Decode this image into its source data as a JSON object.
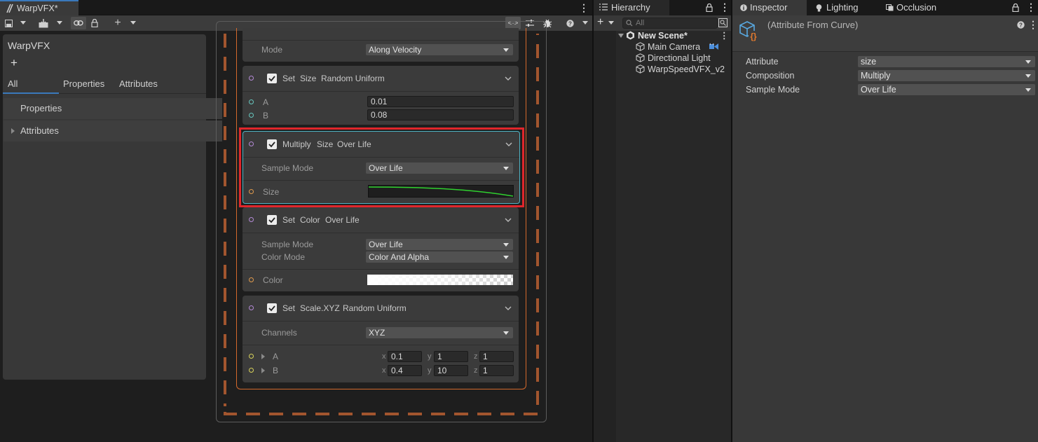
{
  "vfx": {
    "tab_title": "WarpVFX*",
    "blackboard": {
      "title": "WarpVFX",
      "add": "+",
      "tabs": [
        "All",
        "Properties",
        "Attributes"
      ],
      "rows": [
        "Properties",
        "Attributes"
      ]
    },
    "blocks": {
      "top": {
        "mode_label": "Mode",
        "mode_value": "Along Velocity"
      },
      "set_size": {
        "words": [
          "Set",
          "Size",
          "Random Uniform"
        ],
        "a_label": "A",
        "a_value": "0.01",
        "b_label": "B",
        "b_value": "0.08"
      },
      "multiply_size": {
        "words": [
          "Multiply",
          "Size",
          "Over Life"
        ],
        "sample_label": "Sample Mode",
        "sample_value": "Over Life",
        "size_label": "Size"
      },
      "set_color": {
        "words": [
          "Set",
          "Color",
          "Over Life"
        ],
        "sample_label": "Sample Mode",
        "sample_value": "Over Life",
        "colormode_label": "Color Mode",
        "colormode_value": "Color And Alpha",
        "color_label": "Color"
      },
      "set_scale": {
        "words": [
          "Set",
          "Scale.XYZ",
          "Random Uniform"
        ],
        "channels_label": "Channels",
        "channels_value": "XYZ",
        "a_label": "A",
        "a": [
          "0.1",
          "1",
          "1"
        ],
        "b_label": "B",
        "b": [
          "0.4",
          "10",
          "1"
        ],
        "axes": [
          "x",
          "y",
          "z"
        ]
      }
    },
    "colors": {
      "selection": "#e0262b",
      "context_outline": "#d4692c",
      "curve": "#2fd12f",
      "accent": "#3a79bb"
    }
  },
  "hierarchy": {
    "tab": "Hierarchy",
    "search_placeholder": "All",
    "scene": "New Scene*",
    "items": [
      "Main Camera",
      "Directional Light",
      "WarpSpeedVFX_v2"
    ]
  },
  "inspector": {
    "tabs": [
      "Inspector",
      "Lighting",
      "Occlusion"
    ],
    "title": "(Attribute From Curve)",
    "rows": [
      {
        "label": "Attribute",
        "value": "size"
      },
      {
        "label": "Composition",
        "value": "Multiply"
      },
      {
        "label": "Sample Mode",
        "value": "Over Life"
      }
    ]
  }
}
